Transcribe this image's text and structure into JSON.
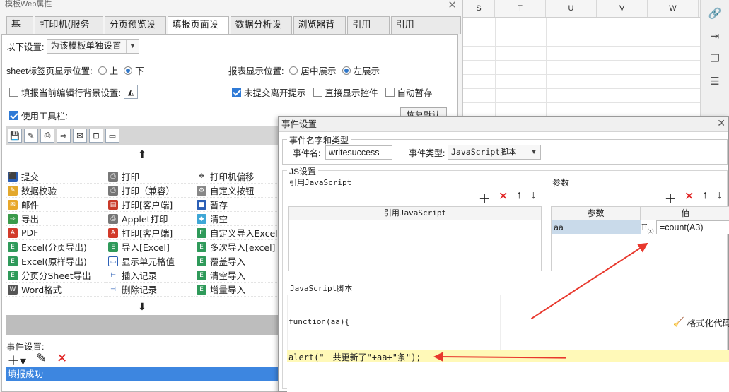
{
  "spreadsheet": {
    "columns": [
      "S",
      "T",
      "U",
      "V",
      "W"
    ]
  },
  "right_toolbar": {
    "icons": [
      "link-icon",
      "import-icon",
      "copy-icon",
      "tree-icon"
    ]
  },
  "panel": {
    "title": "模板Web属性",
    "tabs": [
      {
        "label": "基本"
      },
      {
        "label": "打印机(服务器)"
      },
      {
        "label": "分页预览设置"
      },
      {
        "label": "填报页面设置",
        "active": true
      },
      {
        "label": "数据分析设置"
      },
      {
        "label": "浏览器背景"
      },
      {
        "label": "引用Css"
      },
      {
        "label": "引用JavaScript"
      }
    ],
    "settings_label": "以下设置:",
    "settings_select": "为该模板单独设置",
    "sheet_tab_label": "sheet标签页显示位置:",
    "sheet_tab_options": [
      "上",
      "下"
    ],
    "report_pos_label": "报表显示位置:",
    "report_pos_options": [
      "居中展示",
      "左展示"
    ],
    "fill_bg_label": "填报当前编辑行背景设置:",
    "unsubmitted_label": "未提交离开提示",
    "direct_show_label": "直接显示控件",
    "autosave_label": "自动暂存",
    "use_toolbar_label": "使用工具栏:",
    "restore_default": "恢复默认",
    "buttons": [
      [
        "提交",
        "打印",
        "打印机偏移"
      ],
      [
        "数据校验",
        "打印（兼容）",
        "自定义按钮"
      ],
      [
        "邮件",
        "打印[客户端]",
        "暂存"
      ],
      [
        "导出",
        "Applet打印",
        "清空"
      ],
      [
        "PDF",
        "打印[客户端]",
        "自定义导入Excel行"
      ],
      [
        "Excel(分页导出)",
        "导入[Excel]",
        "多次导入[excel]"
      ],
      [
        "Excel(原样导出)",
        "显示单元格值",
        "覆盖导入"
      ],
      [
        "分页分Sheet导出",
        "插入记录",
        "清空导入"
      ],
      [
        "Word格式",
        "删除记录",
        "增量导入"
      ]
    ],
    "event_label": "事件设置:",
    "event_items": [
      "填报成功"
    ]
  },
  "dialog": {
    "title": "事件设置",
    "group_name_type": "事件名字和类型",
    "event_name_label": "事件名:",
    "event_name_value": "writesuccess",
    "event_type_label": "事件类型:",
    "event_type_value": "JavaScript脚本",
    "group_js": "JS设置",
    "ref_js_label": "引用JavaScript",
    "params_label": "参数",
    "ref_js_col": "引用JavaScript",
    "param_col": "参数",
    "value_col": "值",
    "param_name": "aa",
    "param_value": "=count(A3)",
    "script_label": "JavaScript脚本",
    "script_signature": "function(aa){",
    "format_code": "格式化代码",
    "code_line": "alert(\"一共更新了\"+aa+\"条\");",
    "highlight_color": "#fff9b8",
    "arrow_color": "#e8382d"
  }
}
